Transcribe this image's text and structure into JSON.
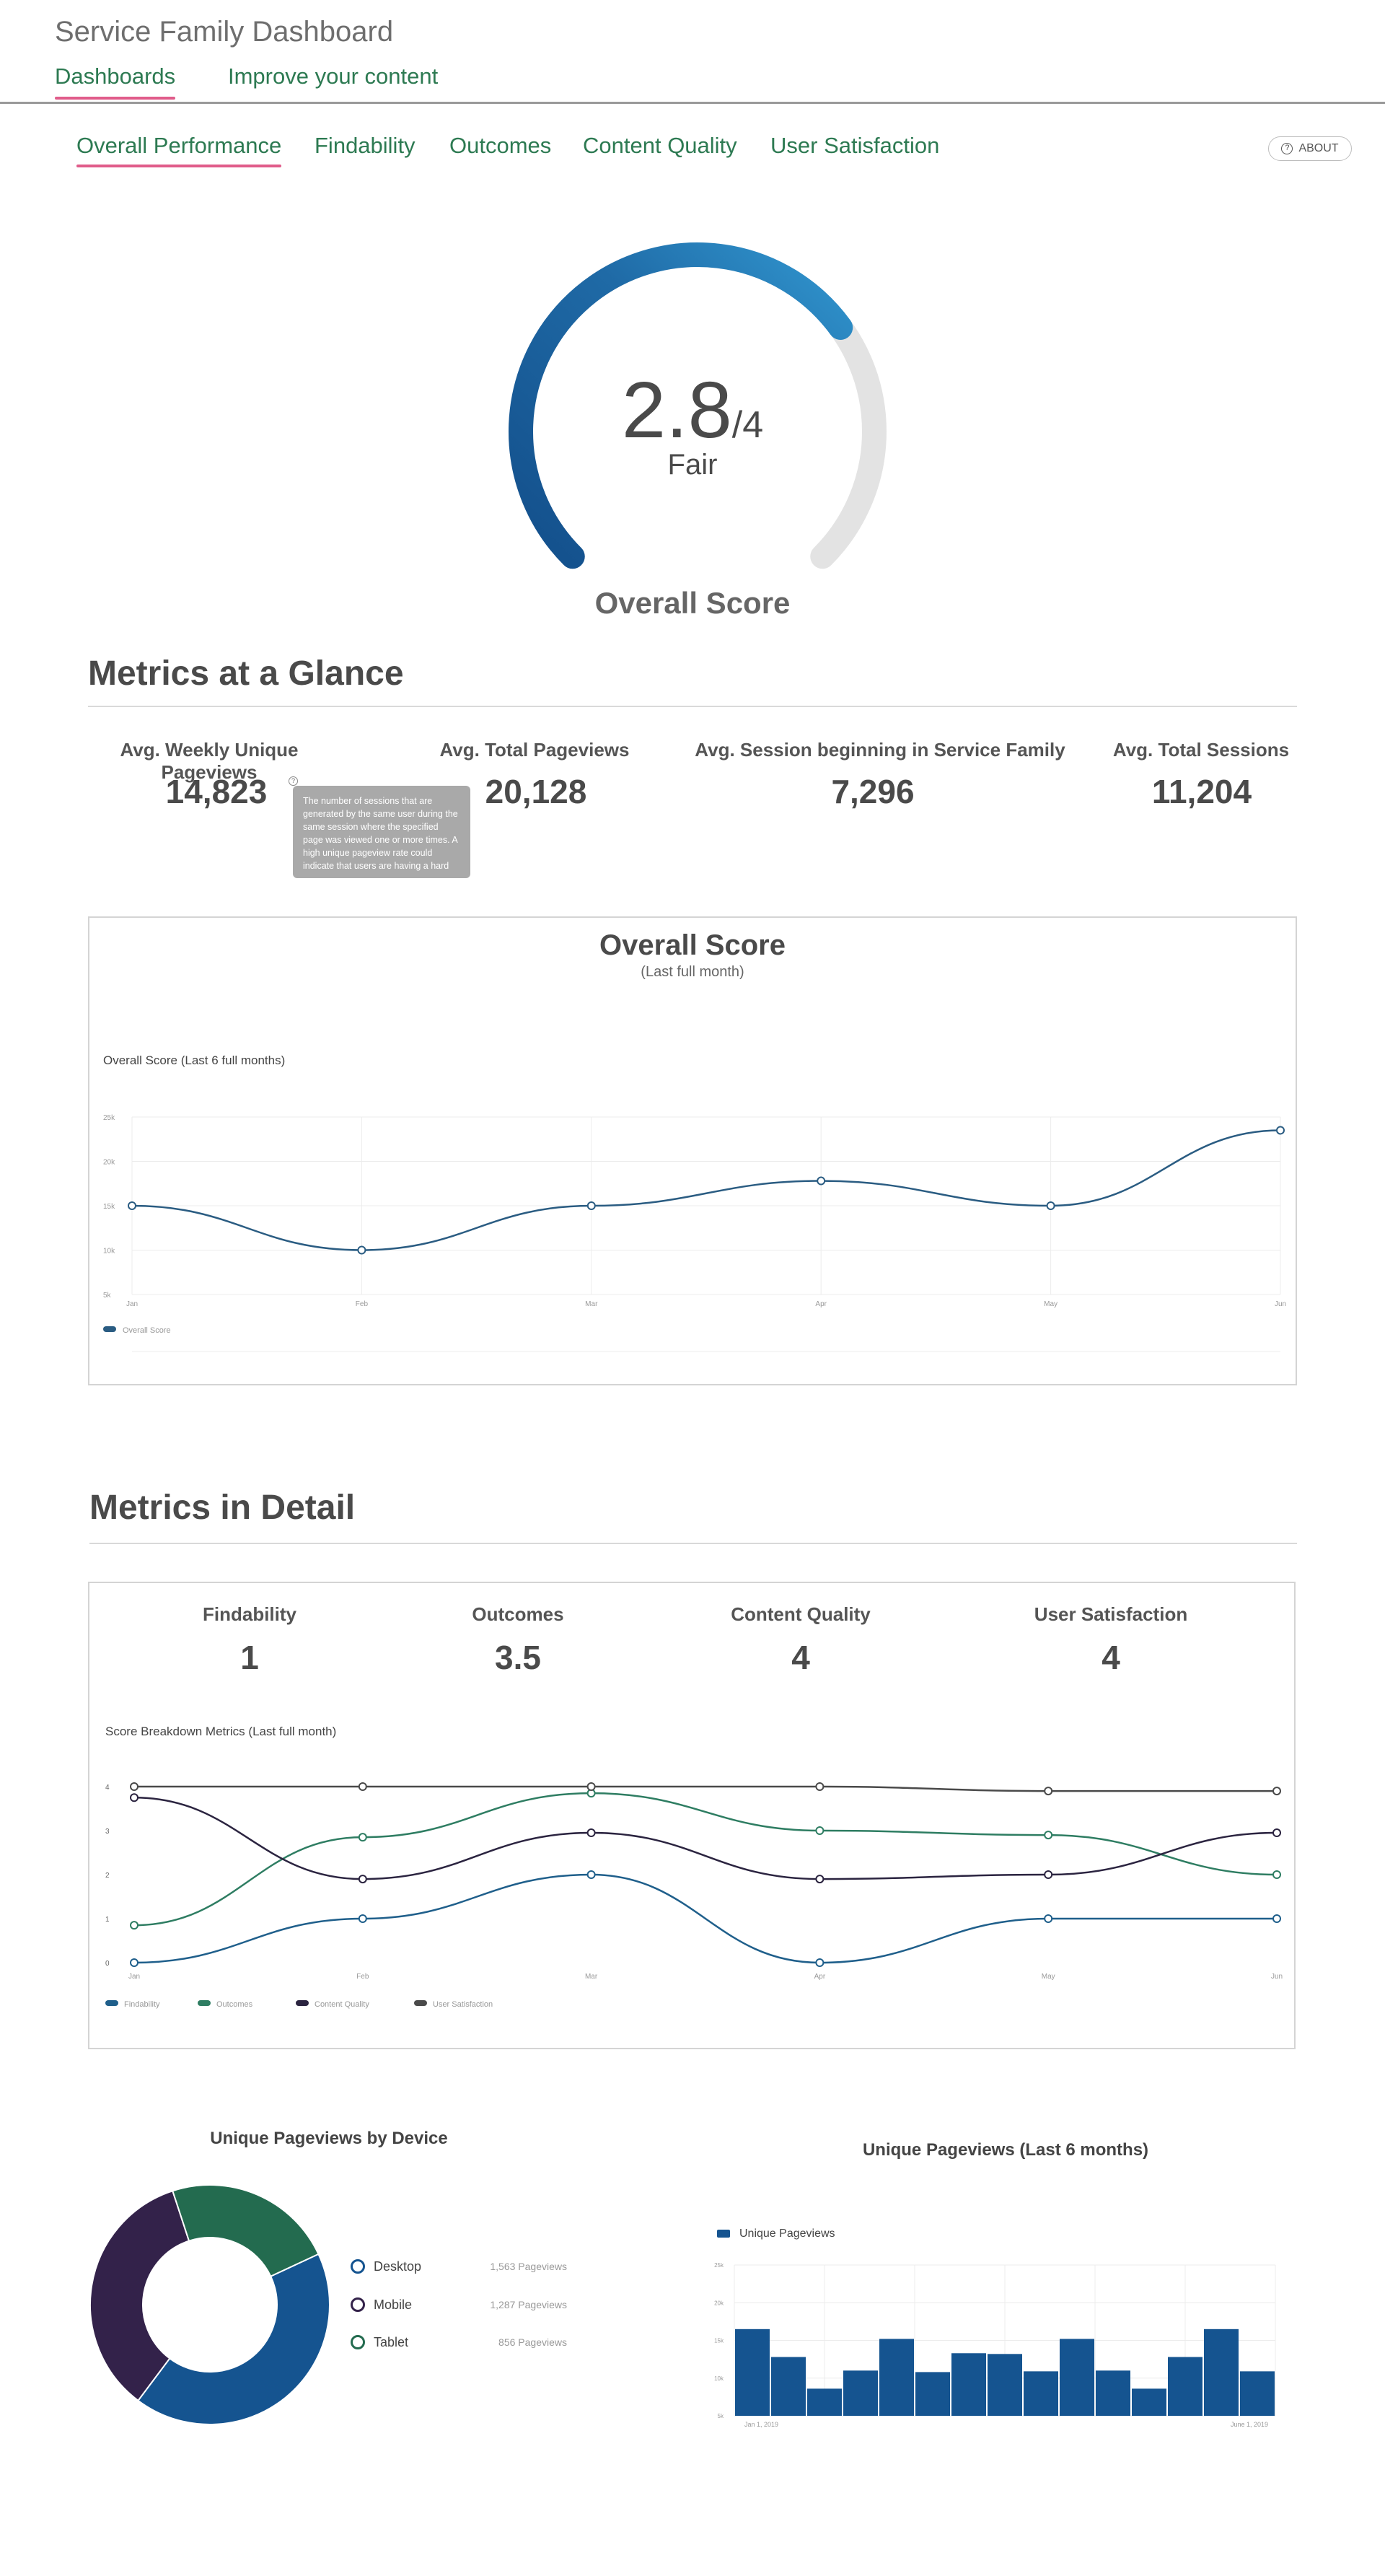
{
  "app": {
    "title": "Service Family Dashboard",
    "nav": [
      {
        "label": "Dashboards",
        "active": true
      },
      {
        "label": "Improve your content",
        "active": false
      }
    ]
  },
  "subnav": {
    "tabs": [
      {
        "label": "Overall Performance",
        "active": true
      },
      {
        "label": "Findability",
        "active": false
      },
      {
        "label": "Outcomes",
        "active": false
      },
      {
        "label": "Content Quality",
        "active": false
      },
      {
        "label": "User Satisfaction",
        "active": false
      }
    ],
    "about_label": "ABOUT"
  },
  "gauge": {
    "value": "2.8",
    "denominator": "/4",
    "value_number": 2.8,
    "max_number": 4,
    "rating": "Fair",
    "caption": "Overall Score",
    "fill_color": "#1b5e96",
    "track_color": "#e3e3e3"
  },
  "glance": {
    "title": "Metrics at a Glance",
    "stats": [
      {
        "label": "Avg. Weekly Unique Pageviews",
        "value": "14,823"
      },
      {
        "label": "Avg. Total Pageviews",
        "value": "20,128"
      },
      {
        "label": "Avg. Session beginning in Service Family",
        "value": "7,296"
      },
      {
        "label": "Avg. Total Sessions",
        "value": "11,204"
      }
    ],
    "tooltip": "The number of sessions that are generated by the same user during the same session where the specified page was viewed one or more times. A high unique pageview rate could indicate that users are having a hard"
  },
  "overall_chart_card": {
    "title": "Overall Score",
    "subtitle": "(Last full month)",
    "chart_label": "Overall Score (Last 6 full months)"
  },
  "detail": {
    "title": "Metrics in Detail",
    "scores": [
      {
        "label": "Findability",
        "value": "1"
      },
      {
        "label": "Outcomes",
        "value": "3.5"
      },
      {
        "label": "Content Quality",
        "value": "4"
      },
      {
        "label": "User Satisfaction",
        "value": "4"
      }
    ],
    "chart_label": "Score Breakdown Metrics (Last full month)"
  },
  "device": {
    "title": "Unique Pageviews by Device",
    "items": [
      {
        "label": "Desktop",
        "count": "1,563 Pageviews",
        "value": 1563,
        "color": "#155490"
      },
      {
        "label": "Mobile",
        "count": "1,287 Pageviews",
        "value": 1287,
        "color": "#33224a"
      },
      {
        "label": "Tablet",
        "count": "856 Pageviews",
        "value": 856,
        "color": "#236b4f"
      }
    ]
  },
  "pageviews_card": {
    "title": "Unique Pageviews (Last 6 months)"
  },
  "chart_data": [
    {
      "type": "line",
      "title": "Overall Score (Last 6 full months)",
      "categories": [
        "Jan",
        "Feb",
        "Mar",
        "Apr",
        "May",
        "Jun"
      ],
      "y_ticks": [
        "5k",
        "10k",
        "15k",
        "20k",
        "25k"
      ],
      "ylim": [
        5000,
        25000
      ],
      "grid": true,
      "legend": "bottom-left",
      "series": [
        {
          "name": "Overall Score",
          "color": "#2a5c82",
          "values": [
            15000,
            10000,
            15000,
            17800,
            15000,
            23500
          ]
        }
      ]
    },
    {
      "type": "line",
      "title": "Score Breakdown Metrics (Last full month)",
      "categories": [
        "Jan",
        "Feb",
        "Mar",
        "Apr",
        "May",
        "Jun"
      ],
      "y_ticks": [
        "0",
        "1",
        "2",
        "3",
        "4"
      ],
      "ylim": [
        0,
        4
      ],
      "grid": false,
      "legend": "bottom-left",
      "series": [
        {
          "name": "Findability",
          "color": "#1f5f8b",
          "values": [
            0,
            1,
            2,
            0,
            1,
            1
          ]
        },
        {
          "name": "Outcomes",
          "color": "#2e7d62",
          "values": [
            0.85,
            2.85,
            3.85,
            3,
            2.9,
            2
          ]
        },
        {
          "name": "Content Quality",
          "color": "#2b2440",
          "values": [
            3.75,
            1.9,
            2.95,
            1.9,
            2,
            2.95
          ]
        },
        {
          "name": "User Satisfaction",
          "color": "#4a4a4a",
          "values": [
            4,
            4,
            4,
            4,
            3.9,
            3.9
          ]
        }
      ]
    },
    {
      "type": "bar",
      "title": "Unique Pageviews (Last 6 months)",
      "x_ticks": [
        "Jan 1, 2019",
        "June 1, 2019"
      ],
      "y_ticks": [
        "5k",
        "10k",
        "15k",
        "20k",
        "25k"
      ],
      "ylim": [
        5000,
        25000
      ],
      "grid": true,
      "legend": "top-left",
      "series": [
        {
          "name": "Unique Pageviews",
          "color": "#155490",
          "values": [
            16500,
            12800,
            8600,
            11000,
            15200,
            10800,
            13300,
            13200,
            10900,
            15200,
            11000,
            8600,
            12800,
            16500,
            10900
          ]
        }
      ]
    }
  ]
}
